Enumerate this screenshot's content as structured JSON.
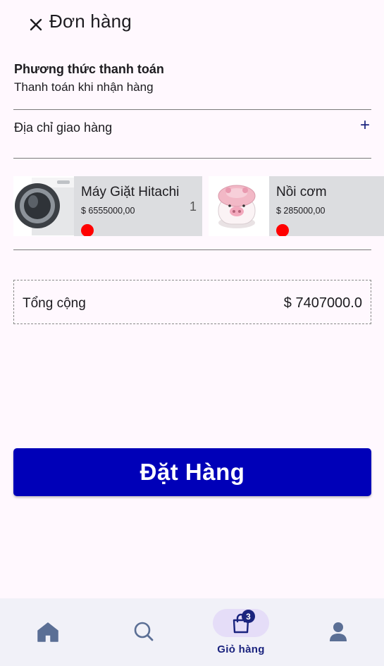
{
  "header": {
    "title": "Đơn hàng",
    "close_icon": "close-icon"
  },
  "payment": {
    "title": "Phương thức thanh toán",
    "value": "Thanh toán khi nhận hàng"
  },
  "address": {
    "label": "Địa chỉ giao hàng",
    "add_symbol": "+"
  },
  "products": [
    {
      "name": "Máy Giặt Hitachi",
      "price": "$ 6555000,00",
      "quantity": "1",
      "image": "washing-machine-image"
    },
    {
      "name": "Nồi cơm",
      "price": "$ 285000,00",
      "image": "rice-cooker-image"
    }
  ],
  "total": {
    "label": "Tổng cộng",
    "value": "$ 7407000.0"
  },
  "order_button": {
    "label": "Đặt Hàng"
  },
  "nav": {
    "items": [
      {
        "icon": "home-icon"
      },
      {
        "icon": "search-icon"
      },
      {
        "icon": "shopping-bag-icon",
        "label": "Giỏ hàng",
        "badge": "3",
        "active": true
      },
      {
        "icon": "profile-icon"
      }
    ]
  },
  "colors": {
    "primary": "#0000b8",
    "accent": "#1a237e",
    "card_bg": "#dcdde0",
    "dot": "#ff0000",
    "nav_bg": "#f1f1f8"
  }
}
